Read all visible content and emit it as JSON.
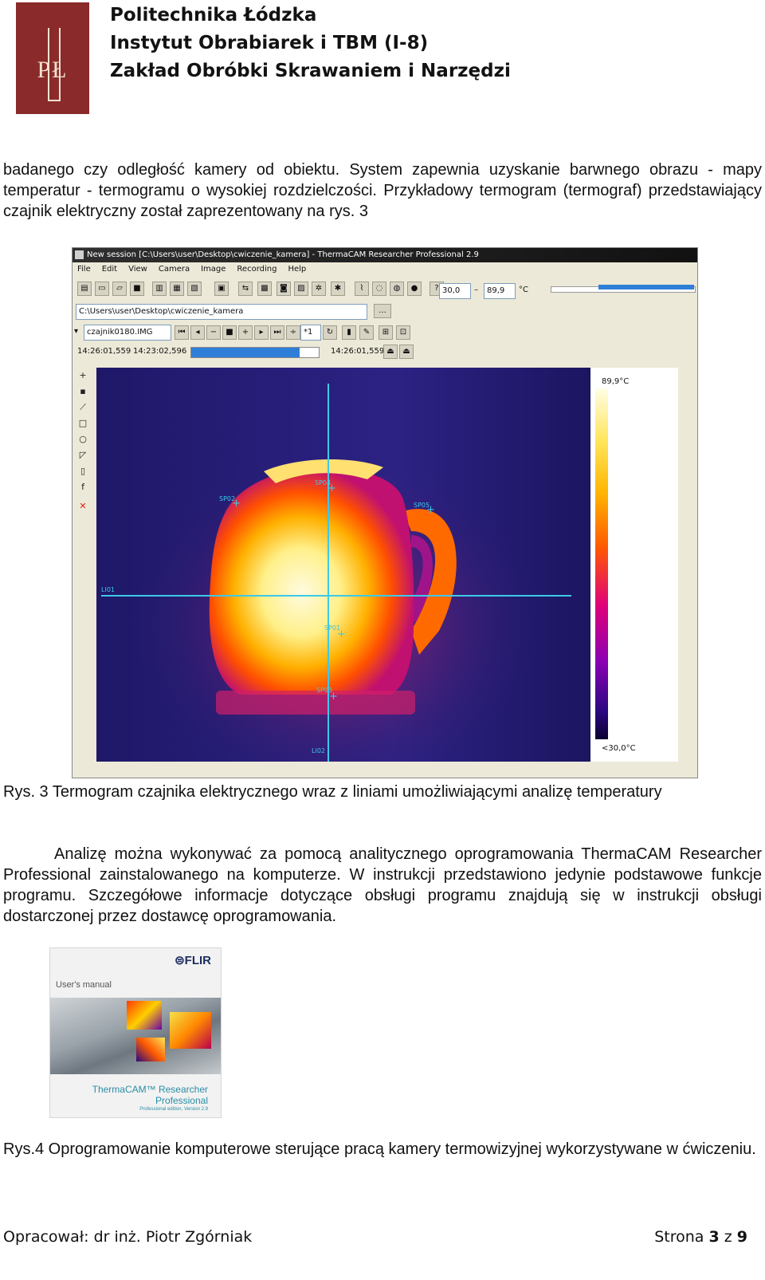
{
  "header": {
    "logo_text": "PŁ",
    "line1": "Politechnika Łódzka",
    "line2": "Instytut Obrabiarek i TBM (I-8)",
    "line3": "Zakład Obróbki Skrawaniem i Narzędzi"
  },
  "body": {
    "para1": "badanego czy odległość kamery od obiektu. System zapewnia uzyskanie barwnego obrazu - mapy temperatur - termogramu o wysokiej rozdzielczości. Przykładowy termogram (termograf) przedstawiający czajnik elektryczny został zaprezentowany na rys. 3",
    "caption3": "Rys. 3 Termogram czajnika elektrycznego wraz z liniami umożliwiającymi analizę temperatury",
    "para2": "Analizę można wykonywać za pomocą analitycznego oprogramowania ThermaCAM Researcher Professional zainstalowanego na komputerze. W instrukcji przedstawiono jedynie podstawowe funkcje programu. Szczegółowe informacje dotyczące obsługi programu znajdują się w instrukcji obsługi dostarczonej przez dostawcę oprogramowania.",
    "caption4": "Rys.4 Oprogramowanie komputerowe sterujące pracą kamery termowizyjnej wykorzystywane w ćwiczeniu."
  },
  "app": {
    "title": "New session [C:\\Users\\user\\Desktop\\cwiczenie_kamera] - ThermaCAM Researcher Professional 2.9",
    "menu": [
      "File",
      "Edit",
      "View",
      "Camera",
      "Image",
      "Recording",
      "Help"
    ],
    "range_min": "30,0",
    "range_max": "89,9",
    "unit": "°C",
    "path": "C:\\Users\\user\\Desktop\\cwiczenie_kamera",
    "browse": "...",
    "file": "czajnik0180.IMG",
    "frame_step": "*1",
    "time_start": "14:26:01,559",
    "time_end": "14:23:02,596",
    "time_current": "14:26:01,559",
    "progress": 0.85,
    "scale_max": "89,9°C",
    "scale_min": "<30,0°C",
    "markers": {
      "sp01": "SP01",
      "sp02": "SP02",
      "sp03": "SP03",
      "sp04": "SP04",
      "sp05": "SP05",
      "li01": "LI01",
      "li02": "LI02"
    },
    "colors": {
      "marker": "#3cc9e8",
      "accent": "#2f7fd8"
    }
  },
  "manual": {
    "brand": "⊜FLIR",
    "subtitle": "User's manual",
    "product_line1": "ThermaCAM™ Researcher",
    "product_line2": "Professional",
    "product_line3": "Professional edition, Version 2.9"
  },
  "footer": {
    "author": "Opracował: dr inż. Piotr Zgórniak",
    "page_prefix": "Strona ",
    "page_num": "3",
    "page_mid": " z ",
    "page_total": "9"
  }
}
